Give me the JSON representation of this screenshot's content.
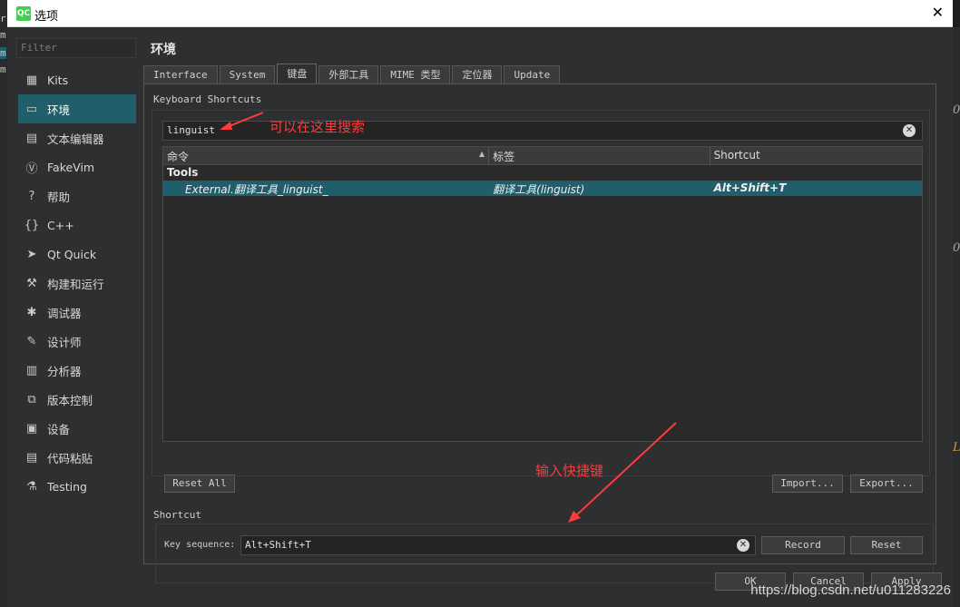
{
  "window": {
    "title": "选项",
    "app_icon_text": "QC",
    "close_glyph": "✕"
  },
  "background_edge": {
    "left_chars": [
      "r",
      "m",
      "m",
      "m"
    ],
    "right_chars": [
      "0",
      "0",
      "L"
    ]
  },
  "sidebar": {
    "filter_placeholder": "Filter",
    "items": [
      {
        "label": "Kits",
        "icon": "kits-icon",
        "glyph": "▦",
        "active": false
      },
      {
        "label": "环境",
        "icon": "monitor-icon",
        "glyph": "▭",
        "active": true
      },
      {
        "label": "文本编辑器",
        "icon": "text-editor-icon",
        "glyph": "▤",
        "active": false
      },
      {
        "label": "FakeVim",
        "icon": "fakevim-icon",
        "glyph": "Ⓥ",
        "active": false
      },
      {
        "label": "帮助",
        "icon": "help-icon",
        "glyph": "?",
        "active": false
      },
      {
        "label": "C++",
        "icon": "braces-icon",
        "glyph": "{}",
        "active": false
      },
      {
        "label": "Qt Quick",
        "icon": "paper-plane-icon",
        "glyph": "➤",
        "active": false
      },
      {
        "label": "构建和运行",
        "icon": "hammer-icon",
        "glyph": "⚒",
        "active": false
      },
      {
        "label": "调试器",
        "icon": "bug-icon",
        "glyph": "✱",
        "active": false
      },
      {
        "label": "设计师",
        "icon": "pencil-icon",
        "glyph": "✎",
        "active": false
      },
      {
        "label": "分析器",
        "icon": "analyzer-icon",
        "glyph": "▥",
        "active": false
      },
      {
        "label": "版本控制",
        "icon": "version-control-icon",
        "glyph": "⧉",
        "active": false
      },
      {
        "label": "设备",
        "icon": "device-icon",
        "glyph": "▣",
        "active": false
      },
      {
        "label": "代码粘贴",
        "icon": "clipboard-icon",
        "glyph": "▤",
        "active": false
      },
      {
        "label": "Testing",
        "icon": "flask-icon",
        "glyph": "⚗",
        "active": false
      }
    ]
  },
  "page": {
    "title": "环境"
  },
  "tabs": [
    {
      "label": "Interface",
      "active": false
    },
    {
      "label": "System",
      "active": false
    },
    {
      "label": "键盘",
      "active": true
    },
    {
      "label": "外部工具",
      "active": false
    },
    {
      "label": "MIME 类型",
      "active": false
    },
    {
      "label": "定位器",
      "active": false
    },
    {
      "label": "Update",
      "active": false
    }
  ],
  "keyboard": {
    "group_title": "Keyboard Shortcuts",
    "search_value": "linguist",
    "table": {
      "columns": [
        "命令",
        "标签",
        "Shortcut"
      ],
      "group": "Tools",
      "rows": [
        {
          "command": "External.翻译工具_linguist_",
          "label": "翻译工具(linguist)",
          "shortcut": "Alt+Shift+T"
        }
      ]
    },
    "reset_all_label": "Reset All",
    "import_label": "Import...",
    "export_label": "Export..."
  },
  "shortcut": {
    "group_title": "Shortcut",
    "key_sequence_label": "Key sequence:",
    "key_sequence_value": "Alt+Shift+T",
    "record_label": "Record",
    "reset_label": "Reset"
  },
  "footer": {
    "ok_label": "OK",
    "cancel_label": "Cancel",
    "apply_label": "Apply"
  },
  "annotations": {
    "search_hint": "可以在这里搜索",
    "input_hint": "输入快捷键",
    "color": "#ff3b3b"
  },
  "watermark": "https://blog.csdn.net/u011283226"
}
